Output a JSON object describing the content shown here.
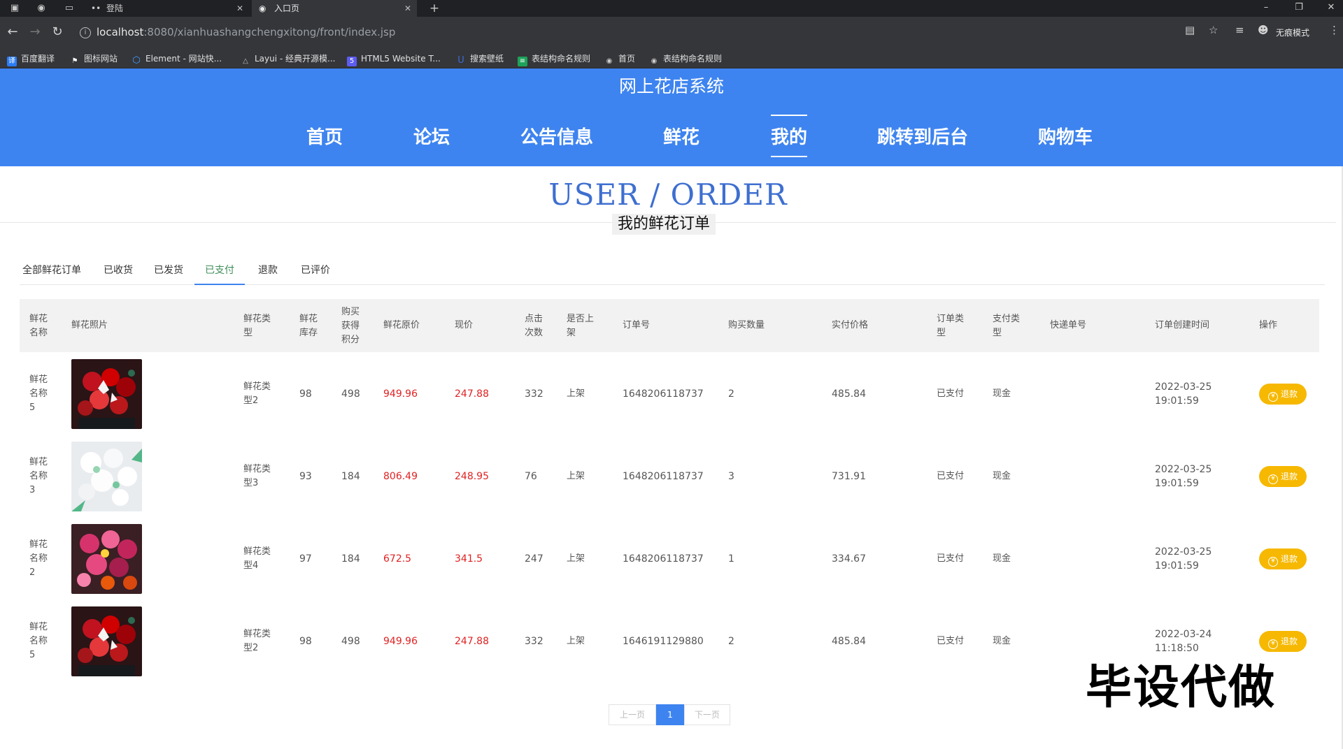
{
  "browser": {
    "tabs": [
      {
        "title": "登陆",
        "icon": "dots-icon"
      },
      {
        "title": "入口页",
        "icon": "globe-icon"
      }
    ],
    "new_tab_symbol": "+",
    "url_host": "localhost",
    "url_path": ":8080/xianhuashangchengxitong/front/index.jsp",
    "incognito_label": "无痕模式",
    "bookmarks": [
      {
        "label": "百度翻译",
        "icon": "translate-icon",
        "color": "#2b7cf6"
      },
      {
        "label": "图标网站",
        "icon": "flag-icon",
        "color": "#ffffff"
      },
      {
        "label": "Element - 网站快...",
        "icon": "element-icon",
        "color": "#409eff"
      },
      {
        "label": "Layui - 经典开源模...",
        "icon": "layui-icon",
        "color": "#bbbbbb"
      },
      {
        "label": "HTML5 Website T...",
        "icon": "html5-icon",
        "color": "#5c5cf0"
      },
      {
        "label": "搜索壁纸",
        "icon": "wallpaper-icon",
        "color": "#3b6cd4"
      },
      {
        "label": "表结构命名规则",
        "icon": "doc-icon",
        "color": "#1ea25a"
      },
      {
        "label": "首页",
        "icon": "globe-icon",
        "color": "#cccccc"
      },
      {
        "label": "表结构命名规则",
        "icon": "globe-icon",
        "color": "#cccccc"
      }
    ]
  },
  "site": {
    "title": "网上花店系统",
    "nav": [
      "首页",
      "论坛",
      "公告信息",
      "鲜花",
      "我的",
      "跳转到后台",
      "购物车"
    ],
    "active_nav": "我的",
    "brand_color": "#3e84f0"
  },
  "section": {
    "title": "USER / ORDER",
    "subtitle": "我的鲜花订单"
  },
  "order_tabs": [
    "全部鲜花订单",
    "已收货",
    "已发货",
    "已支付",
    "退款",
    "已评价"
  ],
  "active_order_tab": "已支付",
  "table": {
    "headers": [
      "鲜花名称",
      "鲜花照片",
      "鲜花类型",
      "鲜花库存",
      "购买获得积分",
      "鲜花原价",
      "现价",
      "点击次数",
      "是否上架",
      "订单号",
      "购买数量",
      "实付价格",
      "订单类型",
      "支付类型",
      "快递单号",
      "订单创建时间",
      "操作"
    ],
    "rows": [
      {
        "name": "鲜花名称5",
        "image": "red-roses-bouquet",
        "type": "鲜花类型2",
        "stock": "98",
        "points": "498",
        "orig_price": "949.96",
        "price": "247.88",
        "clicks": "332",
        "listed": "上架",
        "order_no": "1648206118737",
        "qty": "2",
        "paid": "485.84",
        "order_type": "已支付",
        "pay_type": "现金",
        "express_no": "",
        "created": "2022-03-25 19:01:59",
        "action": "退款"
      },
      {
        "name": "鲜花名称3",
        "image": "white-flowers-bouquet",
        "type": "鲜花类型3",
        "stock": "93",
        "points": "184",
        "orig_price": "806.49",
        "price": "248.95",
        "clicks": "76",
        "listed": "上架",
        "order_no": "1648206118737",
        "qty": "3",
        "paid": "731.91",
        "order_type": "已支付",
        "pay_type": "现金",
        "express_no": "",
        "created": "2022-03-25 19:01:59",
        "action": "退款"
      },
      {
        "name": "鲜花名称2",
        "image": "pink-mixed-bouquet",
        "type": "鲜花类型4",
        "stock": "97",
        "points": "184",
        "orig_price": "672.5",
        "price": "341.5",
        "clicks": "247",
        "listed": "上架",
        "order_no": "1648206118737",
        "qty": "1",
        "paid": "334.67",
        "order_type": "已支付",
        "pay_type": "现金",
        "express_no": "",
        "created": "2022-03-25 19:01:59",
        "action": "退款"
      },
      {
        "name": "鲜花名称5",
        "image": "red-roses-bouquet",
        "type": "鲜花类型2",
        "stock": "98",
        "points": "498",
        "orig_price": "949.96",
        "price": "247.88",
        "clicks": "332",
        "listed": "上架",
        "order_no": "1646191129880",
        "qty": "2",
        "paid": "485.84",
        "order_type": "已支付",
        "pay_type": "现金",
        "express_no": "",
        "created": "2022-03-24 11:18:50",
        "action": "退款"
      }
    ]
  },
  "pagination": {
    "prev": "上一页",
    "current": "1",
    "next": "下一页"
  },
  "watermark": "毕设代做",
  "colors": {
    "price_red": "#e02222",
    "refund_orange": "#f6b800",
    "active_tab_text": "#3e8e59"
  }
}
